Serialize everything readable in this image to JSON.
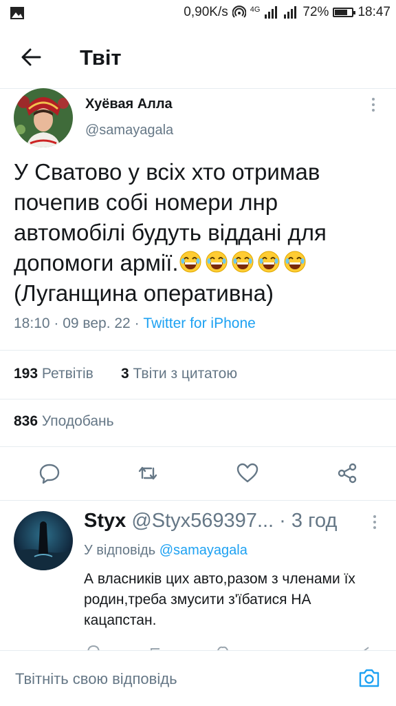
{
  "status_bar": {
    "net_speed": "0,90K/s",
    "network": "4G",
    "battery_percent": "72%",
    "battery_level": 0.72,
    "time": "18:47"
  },
  "header": {
    "title": "Твіт",
    "back_icon": "arrow-left-icon"
  },
  "tweet": {
    "author_name": "Хуёвая Алла",
    "author_handle": "@samayagala",
    "text": "У Сватово у всіх  хто  отримав почепив собі номери лнр автомобілі будуть віддані для допомоги армії.",
    "emoji": [
      "laughing-face",
      "laughing-face",
      "laughing-face",
      "laughing-face",
      "laughing-face"
    ],
    "text_tail": "(Луганщина оперативна)",
    "time": "18:10",
    "date": "09 вер. 22",
    "source": "Twitter for iPhone",
    "retweets_count": "193",
    "retweets_label": "Ретвітів",
    "quotes_count": "3",
    "quotes_label": "Твіти з цитатою",
    "likes_count": "836",
    "likes_label": "Уподобань"
  },
  "actions": [
    "reply-icon",
    "retweet-icon",
    "like-icon",
    "share-icon"
  ],
  "reply": {
    "name": "Styx",
    "handle": "@Styx569397...",
    "age": "3 год",
    "in_reply_label": "У відповідь",
    "in_reply_handle": "@samayagala",
    "text": "А власників цих авто,разом з членами їх родин,треба змусити з'їбатися НА кацапстан."
  },
  "compose": {
    "placeholder": "Твітніть свою відповідь",
    "camera_icon": "camera-icon"
  },
  "colors": {
    "accent": "#1da1f2",
    "secondary_text": "#657786",
    "divider": "#e6ecf0"
  }
}
